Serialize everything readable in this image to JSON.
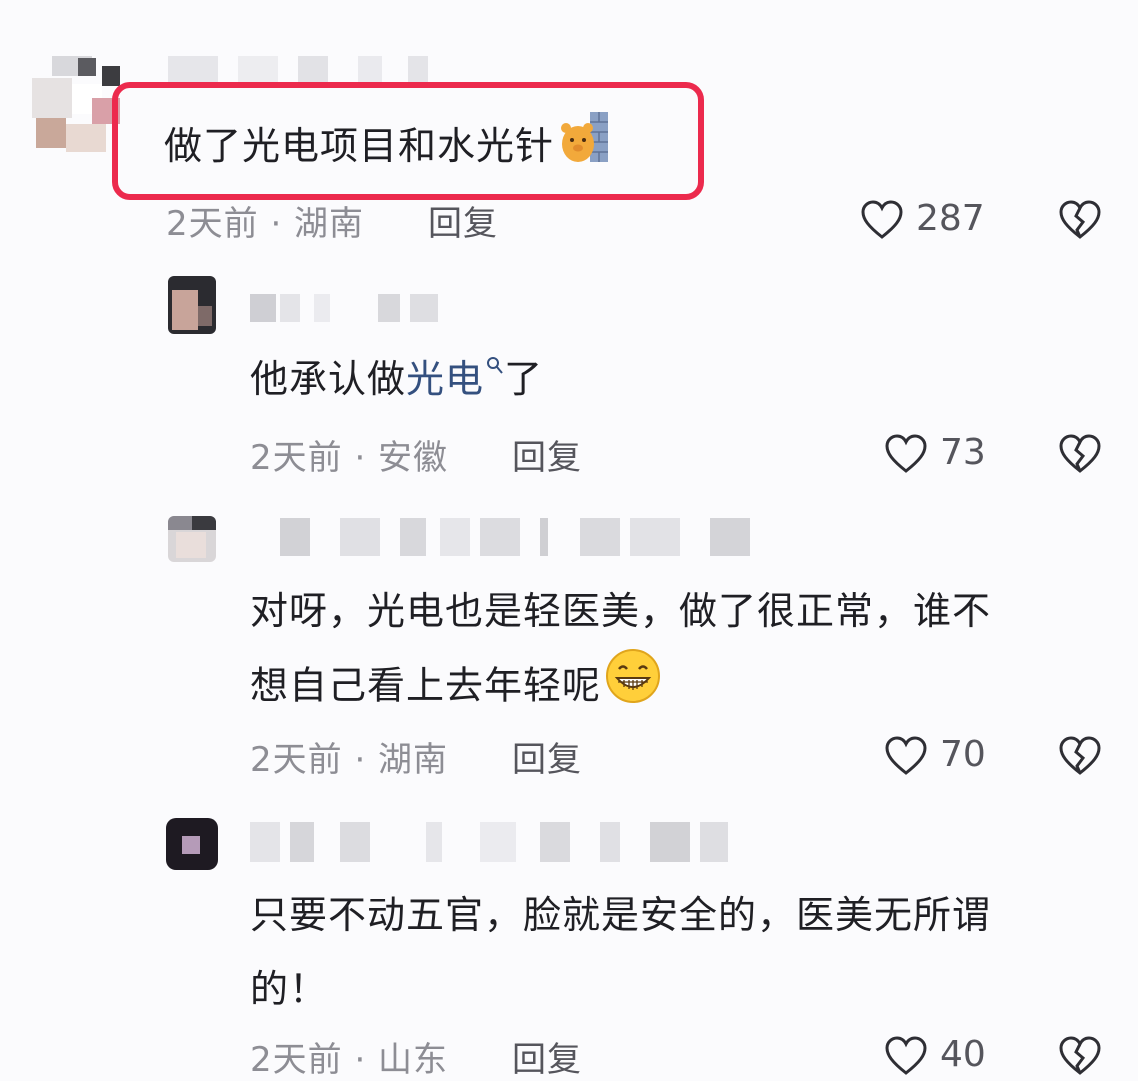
{
  "comments": [
    {
      "text": "做了光电项目和水光针",
      "meta": "2天前 · 湖南",
      "reply_label": "回复",
      "likes": "287"
    },
    {
      "text_before": "他承认做",
      "link_text": "光电",
      "text_after": "了",
      "meta": "2天前 · 安徽",
      "reply_label": "回复",
      "likes": "73"
    },
    {
      "line1": "对呀，光电也是轻医美，做了很正常，谁不",
      "line2": "想自己看上去年轻呢",
      "meta": "2天前 · 湖南",
      "reply_label": "回复",
      "likes": "70"
    },
    {
      "line1": "只要不动五官，脸就是安全的，医美无所谓",
      "line2": "的！",
      "meta": "2天前 · 山东",
      "reply_label": "回复",
      "likes": "40"
    }
  ],
  "colors": {
    "highlight": "#ec2a4d",
    "link": "#34507f",
    "meta": "#8d8d94"
  },
  "icons": [
    "heart-outline-icon",
    "broken-heart-icon",
    "search-icon",
    "bear-wall-emoji",
    "grin-emoji"
  ]
}
